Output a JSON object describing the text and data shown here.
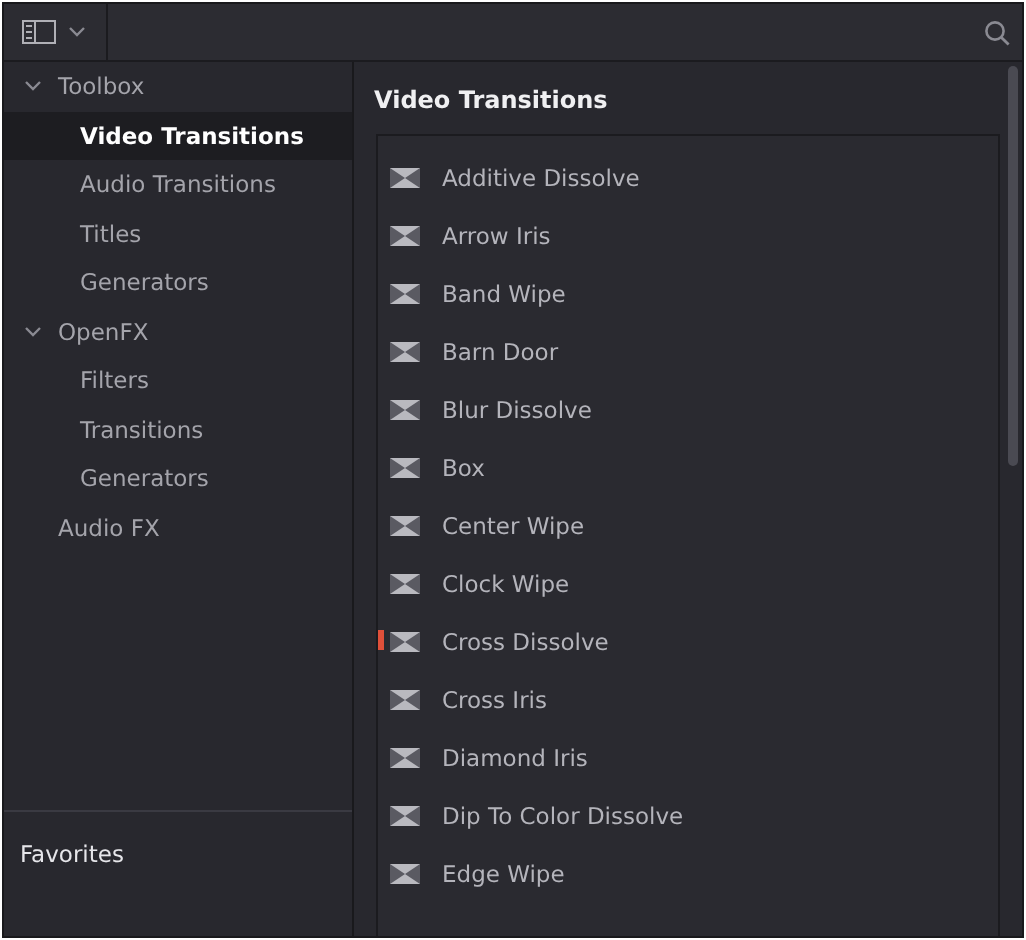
{
  "sidebar": {
    "groups": [
      {
        "label": "Toolbox",
        "expanded": true,
        "children": [
          {
            "label": "Video Transitions",
            "selected": true
          },
          {
            "label": "Audio Transitions",
            "selected": false
          },
          {
            "label": "Titles",
            "selected": false
          },
          {
            "label": "Generators",
            "selected": false
          }
        ]
      },
      {
        "label": "OpenFX",
        "expanded": true,
        "children": [
          {
            "label": "Filters",
            "selected": false
          },
          {
            "label": "Transitions",
            "selected": false
          },
          {
            "label": "Generators",
            "selected": false
          }
        ]
      },
      {
        "label": "Audio FX"
      }
    ],
    "favorites_title": "Favorites"
  },
  "panel": {
    "title": "Video Transitions",
    "items": [
      {
        "label": "Additive Dissolve",
        "marked": false
      },
      {
        "label": "Arrow Iris",
        "marked": false
      },
      {
        "label": "Band Wipe",
        "marked": false
      },
      {
        "label": "Barn Door",
        "marked": false
      },
      {
        "label": "Blur Dissolve",
        "marked": false
      },
      {
        "label": "Box",
        "marked": false
      },
      {
        "label": "Center Wipe",
        "marked": false
      },
      {
        "label": "Clock Wipe",
        "marked": false
      },
      {
        "label": "Cross Dissolve",
        "marked": true
      },
      {
        "label": "Cross Iris",
        "marked": false
      },
      {
        "label": "Diamond Iris",
        "marked": false
      },
      {
        "label": "Dip To Color Dissolve",
        "marked": false
      },
      {
        "label": "Edge Wipe",
        "marked": false
      }
    ]
  }
}
